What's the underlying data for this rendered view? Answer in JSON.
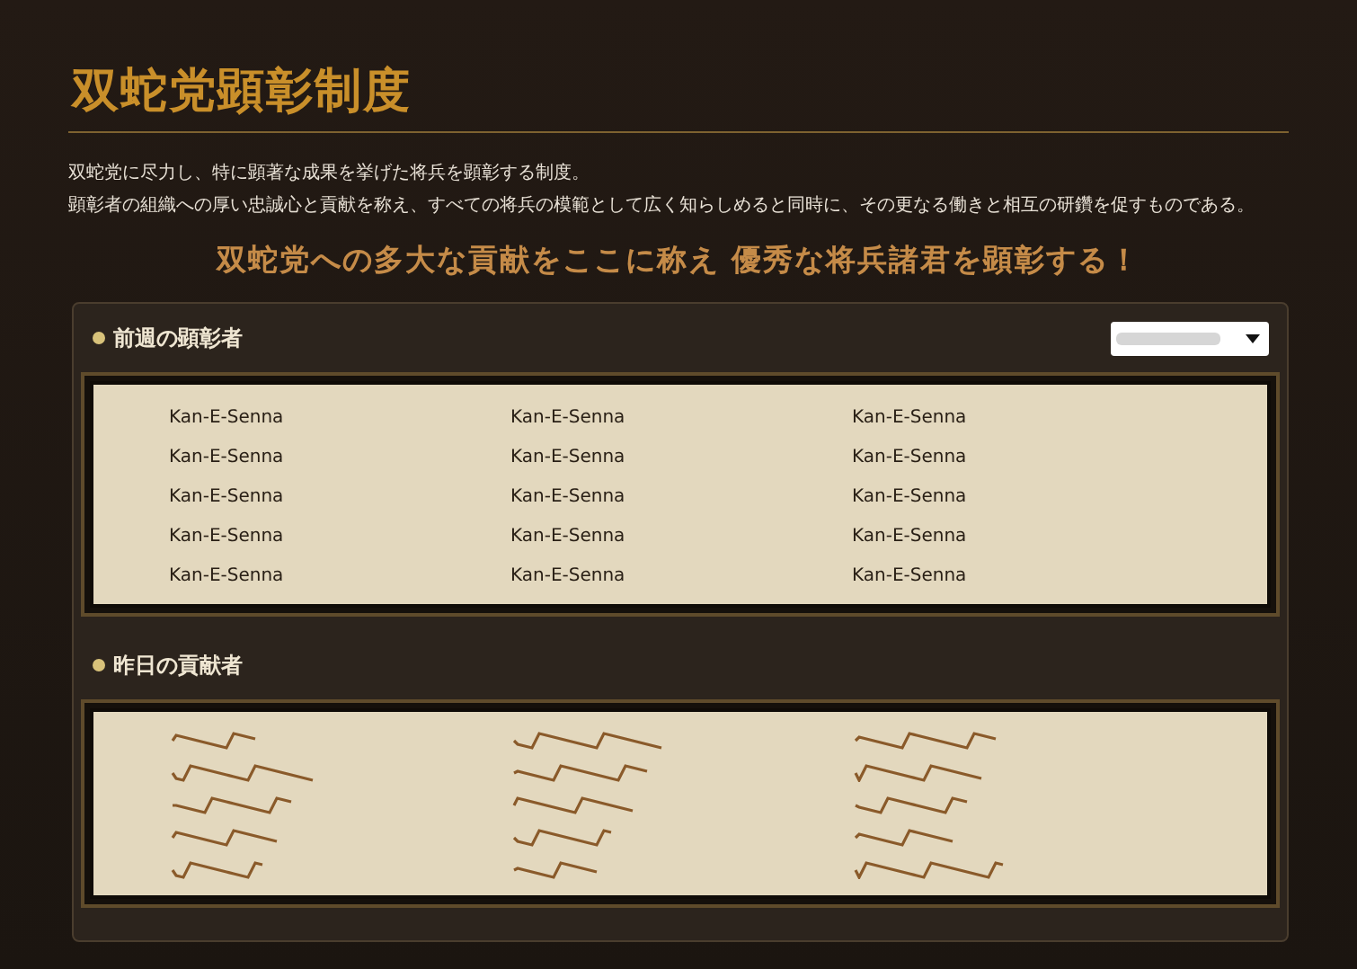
{
  "page": {
    "title": "双蛇党顕彰制度",
    "description": [
      "双蛇党に尽力し、特に顕著な成果を挙げた将兵を顕彰する制度。",
      "顕彰者の組織への厚い忠誠心と貢献を称え、すべての将兵の模範として広く知らしめると同時に、その更なる働きと相互の研鑽を促すものである。"
    ],
    "slogan": "双蛇党への多大な貢献をここに称え 優秀な将兵諸君を顕彰する！"
  },
  "sections": [
    {
      "title": "前週の顕彰者",
      "has_dropdown": true,
      "names": [
        {
          "kind": "text",
          "name": "Kan-E-Senna"
        },
        {
          "kind": "text",
          "name": "Kan-E-Senna"
        },
        {
          "kind": "text",
          "name": "Kan-E-Senna"
        },
        {
          "kind": "text",
          "name": "Kan-E-Senna"
        },
        {
          "kind": "text",
          "name": "Kan-E-Senna"
        },
        {
          "kind": "text",
          "name": "Kan-E-Senna"
        },
        {
          "kind": "text",
          "name": "Kan-E-Senna"
        },
        {
          "kind": "text",
          "name": "Kan-E-Senna"
        },
        {
          "kind": "text",
          "name": "Kan-E-Senna"
        },
        {
          "kind": "text",
          "name": "Kan-E-Senna"
        },
        {
          "kind": "text",
          "name": "Kan-E-Senna"
        },
        {
          "kind": "text",
          "name": "Kan-E-Senna"
        },
        {
          "kind": "text",
          "name": "Kan-E-Senna"
        },
        {
          "kind": "text",
          "name": "Kan-E-Senna"
        },
        {
          "kind": "text",
          "name": "Kan-E-Senna"
        }
      ]
    },
    {
      "title": "昨日の貢献者",
      "has_dropdown": false,
      "names": [
        {
          "kind": "scribble"
        },
        {
          "kind": "scribble"
        },
        {
          "kind": "scribble"
        },
        {
          "kind": "scribble"
        },
        {
          "kind": "scribble"
        },
        {
          "kind": "scribble"
        },
        {
          "kind": "scribble"
        },
        {
          "kind": "scribble"
        },
        {
          "kind": "scribble"
        },
        {
          "kind": "scribble"
        },
        {
          "kind": "scribble"
        },
        {
          "kind": "scribble"
        },
        {
          "kind": "scribble"
        },
        {
          "kind": "scribble"
        },
        {
          "kind": "scribble"
        }
      ]
    }
  ]
}
